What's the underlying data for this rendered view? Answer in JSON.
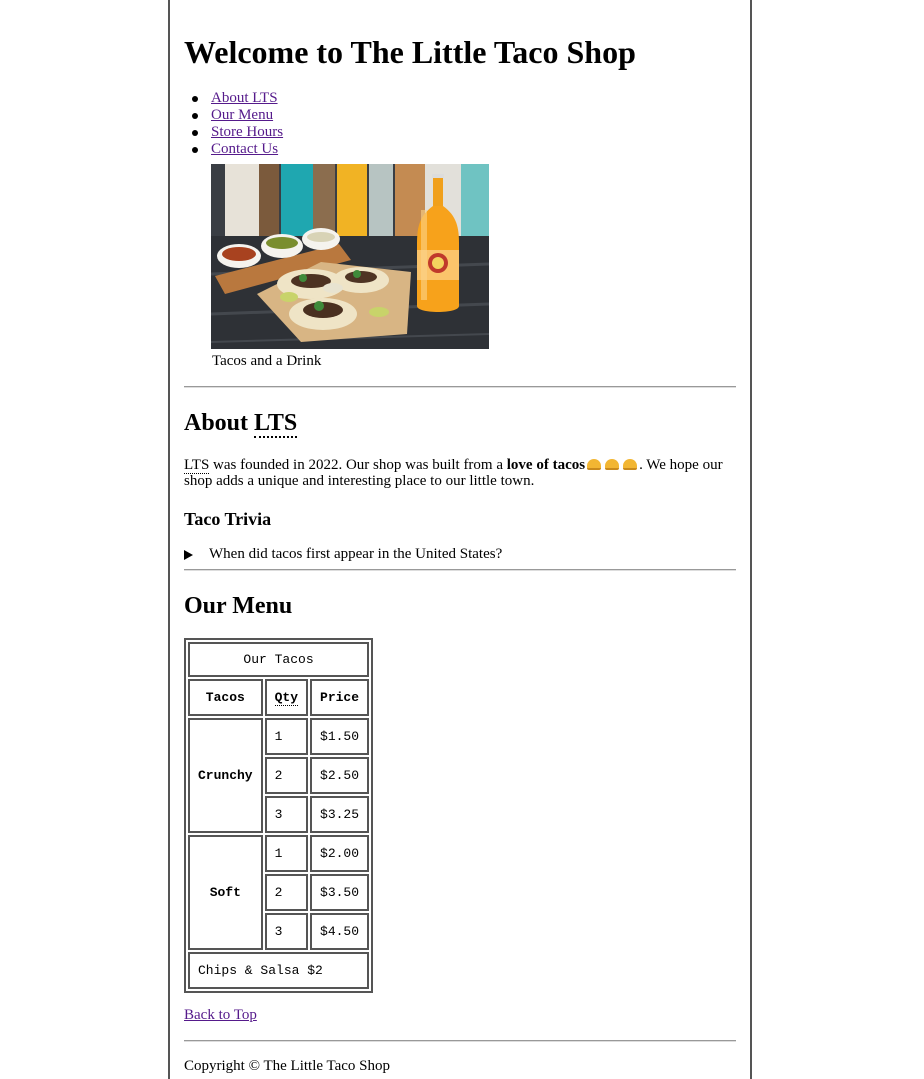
{
  "header": {
    "title": "Welcome to The Little Taco Shop"
  },
  "nav": {
    "items": [
      "About LTS",
      "Our Menu",
      "Store Hours",
      "Contact Us"
    ]
  },
  "figure": {
    "caption": "Tacos and a Drink"
  },
  "about": {
    "heading_prefix": "About ",
    "heading_abbr": "LTS",
    "abbr": "LTS",
    "text_1": " was founded in 2022. Our shop was built from a ",
    "bold": "love of tacos",
    "text_2": ". We hope our shop adds a unique and interesting place to our little town.",
    "trivia_heading": "Taco Trivia",
    "trivia_question": "When did tacos first appear in the United States?"
  },
  "menu": {
    "heading": "Our Menu",
    "caption": "Our Tacos",
    "headers": [
      "Tacos",
      "Qty",
      "Price"
    ],
    "groups": [
      {
        "name": "Crunchy",
        "rows": [
          [
            "1",
            "$1.50"
          ],
          [
            "2",
            "$2.50"
          ],
          [
            "3",
            "$3.25"
          ]
        ]
      },
      {
        "name": "Soft",
        "rows": [
          [
            "1",
            "$2.00"
          ],
          [
            "2",
            "$3.50"
          ],
          [
            "3",
            "$4.50"
          ]
        ]
      }
    ],
    "footer": "Chips & Salsa $2"
  },
  "back_to_top": "Back to Top",
  "footer": {
    "copyright": "Copyright © The Little Taco Shop"
  },
  "colors": {
    "link": "#551a8b",
    "border": "#555555",
    "taco_emoji": "#f2b632",
    "drink": "#f7a21b"
  }
}
